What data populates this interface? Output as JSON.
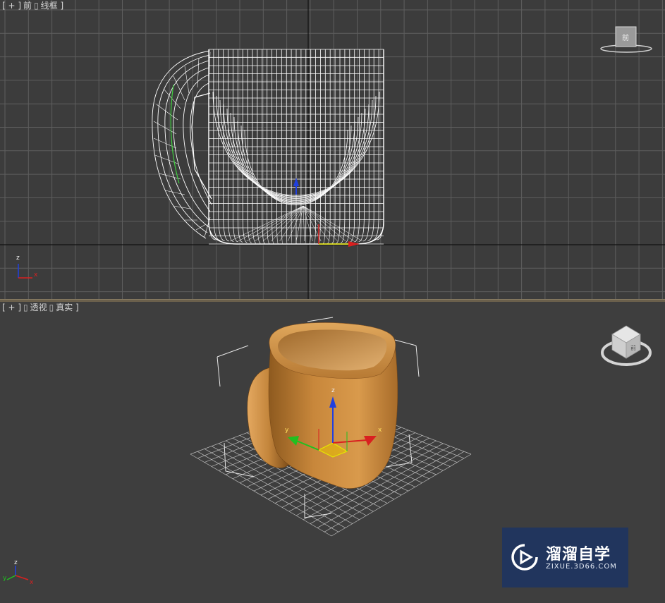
{
  "viewports": {
    "front": {
      "label_plus": "[ + ]",
      "label_view": "前",
      "label_shading": "线框 ]",
      "viewcube_face": "前",
      "axis_z": "z",
      "axis_x": "x"
    },
    "perspective": {
      "label_plus": "[ + ]",
      "label_view": "透视",
      "label_shading": "真实 ]",
      "viewcube_face": "前",
      "gizmo_axis_x": "x",
      "gizmo_axis_y": "y",
      "gizmo_axis_z": "z",
      "axis_z": "z",
      "axis_x": "x",
      "axis_y": "y"
    }
  },
  "watermark": {
    "title": "溜溜自学",
    "subtitle": "ZIXUE.3D66.COM"
  },
  "colors": {
    "viewport_bg": "#3c3c3c",
    "grid_line": "#5e5e5e",
    "grid_axis": "#111111",
    "wireframe": "#ffffff",
    "mug_orange": "#c58a3e",
    "active_border": "#867a62",
    "watermark_bg": "#1e3462",
    "axis_red": "#d92020",
    "axis_green": "#20c020",
    "axis_blue": "#2040e0",
    "gizmo_yellow": "#e6e600"
  },
  "icons": {
    "viewcube": "viewcube-icon",
    "axis_tripod": "axis-tripod-icon",
    "transform_gizmo": "move-gizmo-icon",
    "watermark_logo": "play-logo-icon"
  }
}
